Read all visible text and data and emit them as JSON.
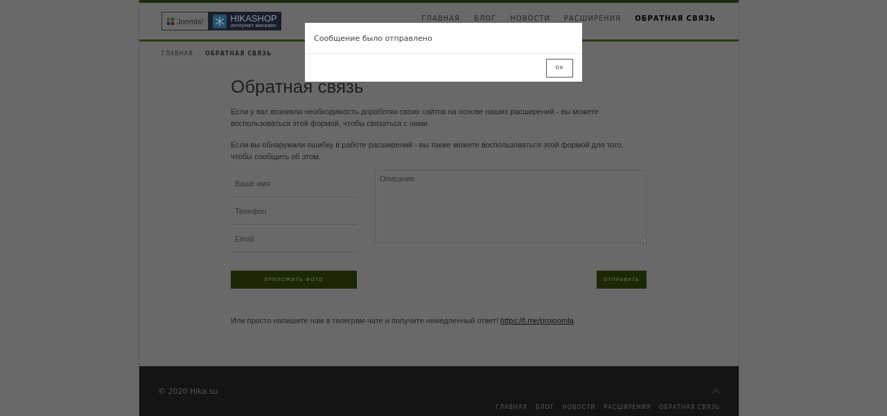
{
  "logo": {
    "joomla": "Joomla!",
    "shop": "HIKASHOP",
    "shop_sub": "интернет магазин"
  },
  "nav": [
    {
      "label": "ГЛАВНАЯ",
      "selected": false
    },
    {
      "label": "БЛОГ",
      "selected": false
    },
    {
      "label": "НОВОСТИ",
      "selected": false
    },
    {
      "label": "РАСШИРЕНИЯ",
      "selected": false
    },
    {
      "label": "ОБРАТНАЯ СВЯЗЬ",
      "selected": true
    }
  ],
  "breadcrumb": [
    "ГЛАВНАЯ",
    "ОБРАТНАЯ СВЯЗЬ"
  ],
  "title": "Обратная связь",
  "paragraphs": [
    "Если у вас возникла необходимость доработки своих сайтов на основе наших расширений - вы можете воспользоваться этой формой, чтобы связаться с нами.",
    "Если вы обнаружили ошибку в работе расширений - вы также можете воспользоваться этой формой для того, чтобы сообщить об этом."
  ],
  "fields": [
    {
      "placeholder": "Ваше имя"
    },
    {
      "placeholder": "Телефон"
    },
    {
      "placeholder": "Email"
    }
  ],
  "description": {
    "placeholder": "Описание"
  },
  "buttons": {
    "attach": "ПРИЛОЖИТЬ ФОТО",
    "send": "ОТПРАВИТЬ"
  },
  "telegram": {
    "text": "Или просто напишите нам в телеграм-чате и получите немедленный ответ!",
    "link": "https://t.me/projoomla"
  },
  "footer": {
    "copyright": "© 2020 Hika.su",
    "nav": [
      "ГЛАВНАЯ",
      "БЛОГ",
      "НОВОСТИ",
      "РАСШИРЕНИЯ",
      "ОБРАТНАЯ СВЯЗЬ"
    ]
  },
  "modal": {
    "message": "Сообщение было отправлено",
    "button": "OK"
  }
}
